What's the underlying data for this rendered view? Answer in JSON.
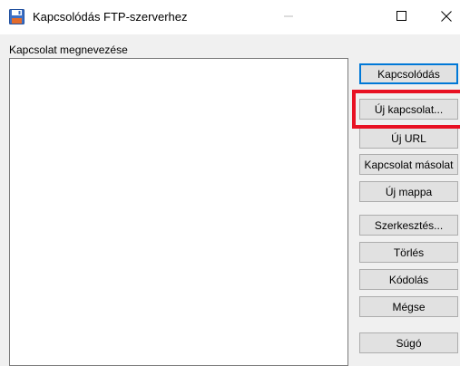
{
  "window": {
    "title": "Kapcsolódás FTP-szerverhez",
    "icon": "floppy-disk-icon"
  },
  "connection_list": {
    "label": "Kapcsolat megnevezése",
    "items": []
  },
  "buttons": {
    "connect": "Kapcsolódás",
    "new_connection": "Új kapcsolat...",
    "new_url": "Új URL",
    "copy_connection": "Kapcsolat másolat",
    "new_folder": "Új mappa",
    "edit": "Szerkesztés...",
    "delete": "Törlés",
    "encoding": "Kódolás",
    "cancel": "Mégse",
    "help": "Súgó"
  },
  "colors": {
    "highlight": "#e81123",
    "default_button_border": "#0078d7",
    "icon": "#3b6fc6"
  }
}
